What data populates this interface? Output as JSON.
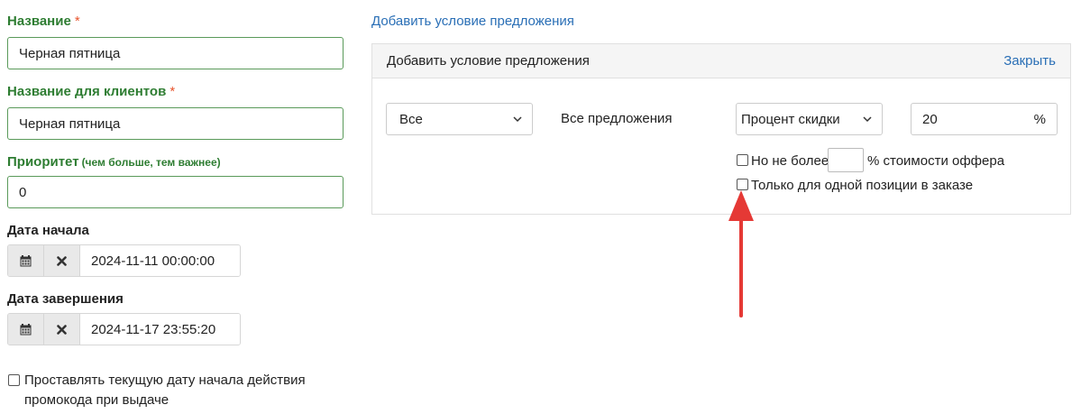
{
  "form": {
    "name_label": "Название",
    "name_required_mark": "*",
    "name_value": "Черная пятница",
    "client_name_label": "Название для клиентов",
    "client_name_required_mark": "*",
    "client_name_value": "Черная пятница",
    "priority_label": "Приоритет",
    "priority_hint": "(чем больше, тем важнее)",
    "priority_value": "0",
    "start_date_label": "Дата начала",
    "start_date_value": "2024-11-11 00:00:00",
    "end_date_label": "Дата завершения",
    "end_date_value": "2024-11-17 23:55:20",
    "set_current_date_label": "Проставлять текущую дату начала действия промокода при выдаче",
    "set_current_date_checked": false
  },
  "condition": {
    "add_link": "Добавить условие предложения",
    "panel_title": "Добавить условие предложения",
    "close_link": "Закрыть",
    "scope_select": "Все",
    "scope_text": "Все предложения",
    "discount_type_select": "Процент скидки",
    "discount_value": "20",
    "discount_unit": "%",
    "max_prefix": "Но не более",
    "max_value": "",
    "max_suffix": "% стоимости оффера",
    "max_checked": false,
    "single_position_label": "Только для одной позиции в заказе",
    "single_position_checked": false
  },
  "icons": {
    "calendar": "calendar-icon",
    "clear": "close-icon",
    "chevron": "chevron-down-icon",
    "arrow": "arrow-up-icon"
  },
  "colors": {
    "label_green": "#2e7d32",
    "required_red": "#e8542d",
    "link_blue": "#2a6fb6",
    "arrow_red": "#e53935"
  }
}
